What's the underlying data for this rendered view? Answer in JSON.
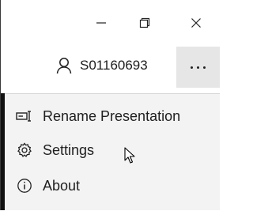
{
  "window_controls": {
    "minimize_icon": "minimize-icon",
    "restore_icon": "restore-icon",
    "close_icon": "close-icon"
  },
  "account": {
    "icon": "person-icon",
    "user_id": "S01160693"
  },
  "more_button": {
    "icon": "more-horizontal-icon"
  },
  "menu": {
    "items": [
      {
        "label": "Rename Presentation",
        "icon": "rename-icon"
      },
      {
        "label": "Settings",
        "icon": "gear-icon"
      },
      {
        "label": "About",
        "icon": "info-icon"
      }
    ]
  },
  "colors": {
    "menu_background": "#f3f3f3",
    "more_button_background": "#e6e6e6",
    "text": "#202020",
    "frame_border": "#3a3a3a"
  }
}
